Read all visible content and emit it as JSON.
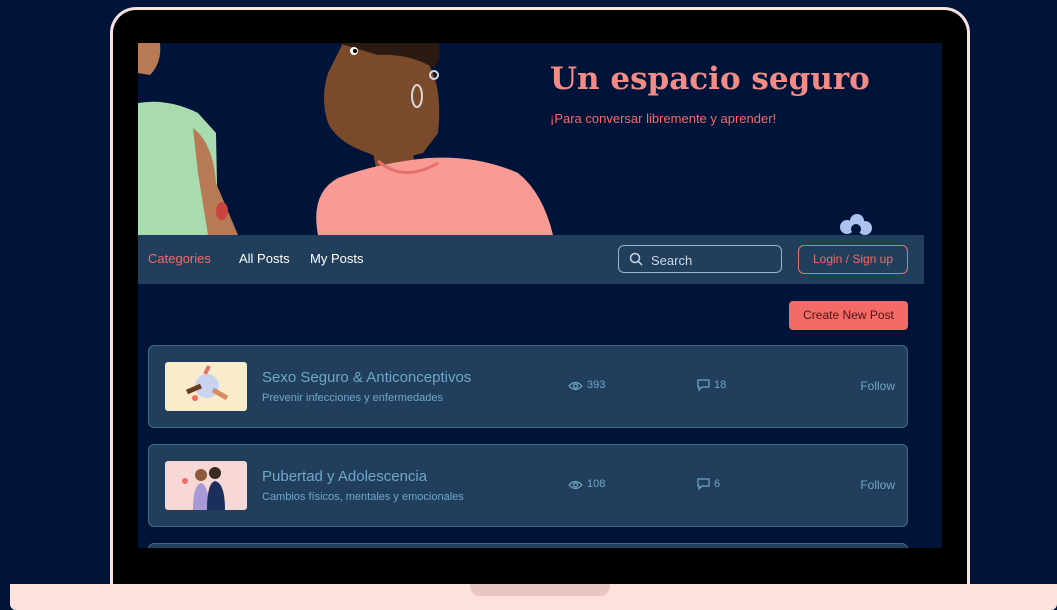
{
  "hero": {
    "title": "Un espacio seguro",
    "subtitle": "¡Para conversar libremente y aprender!"
  },
  "nav": {
    "categories": "Categories",
    "all_posts": "All Posts",
    "my_posts": "My Posts",
    "search_placeholder": "Search",
    "login_label": "Login / Sign up"
  },
  "actions": {
    "create_post_label": "Create New Post"
  },
  "categories": [
    {
      "title": "Sexo Seguro & Anticonceptivos",
      "subtitle": "Prevenir infecciones y enfermedades",
      "views": "393",
      "comments": "18",
      "follow": "Follow"
    },
    {
      "title": "Pubertad y Adolescencia",
      "subtitle": "Cambios físicos, mentales y emocionales",
      "views": "108",
      "comments": "6",
      "follow": "Follow"
    }
  ],
  "colors": {
    "background": "#00143a",
    "accent": "#f46a66",
    "card": "#213f5c",
    "muted_text": "#6fa6c9"
  }
}
